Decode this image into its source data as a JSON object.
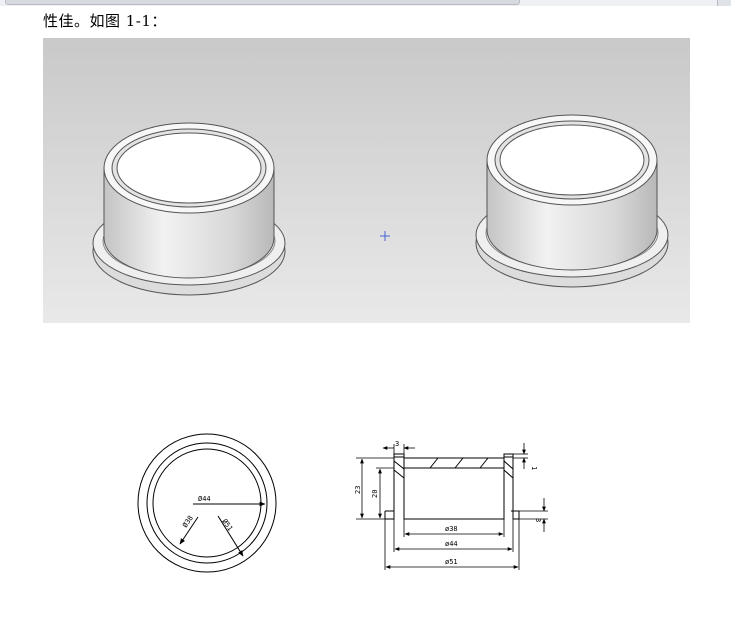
{
  "caption": "性佳。如图 1-1：",
  "drawing": {
    "top_view": {
      "d44": "Ø44",
      "d38": "Ø38",
      "d51": "Ø51"
    },
    "section": {
      "wall": "3",
      "height_total": "23",
      "height_inner": "20",
      "top_gap": "1",
      "flange": "3",
      "d38": "ø38",
      "d44": "ø44",
      "d51": "ø51"
    }
  }
}
